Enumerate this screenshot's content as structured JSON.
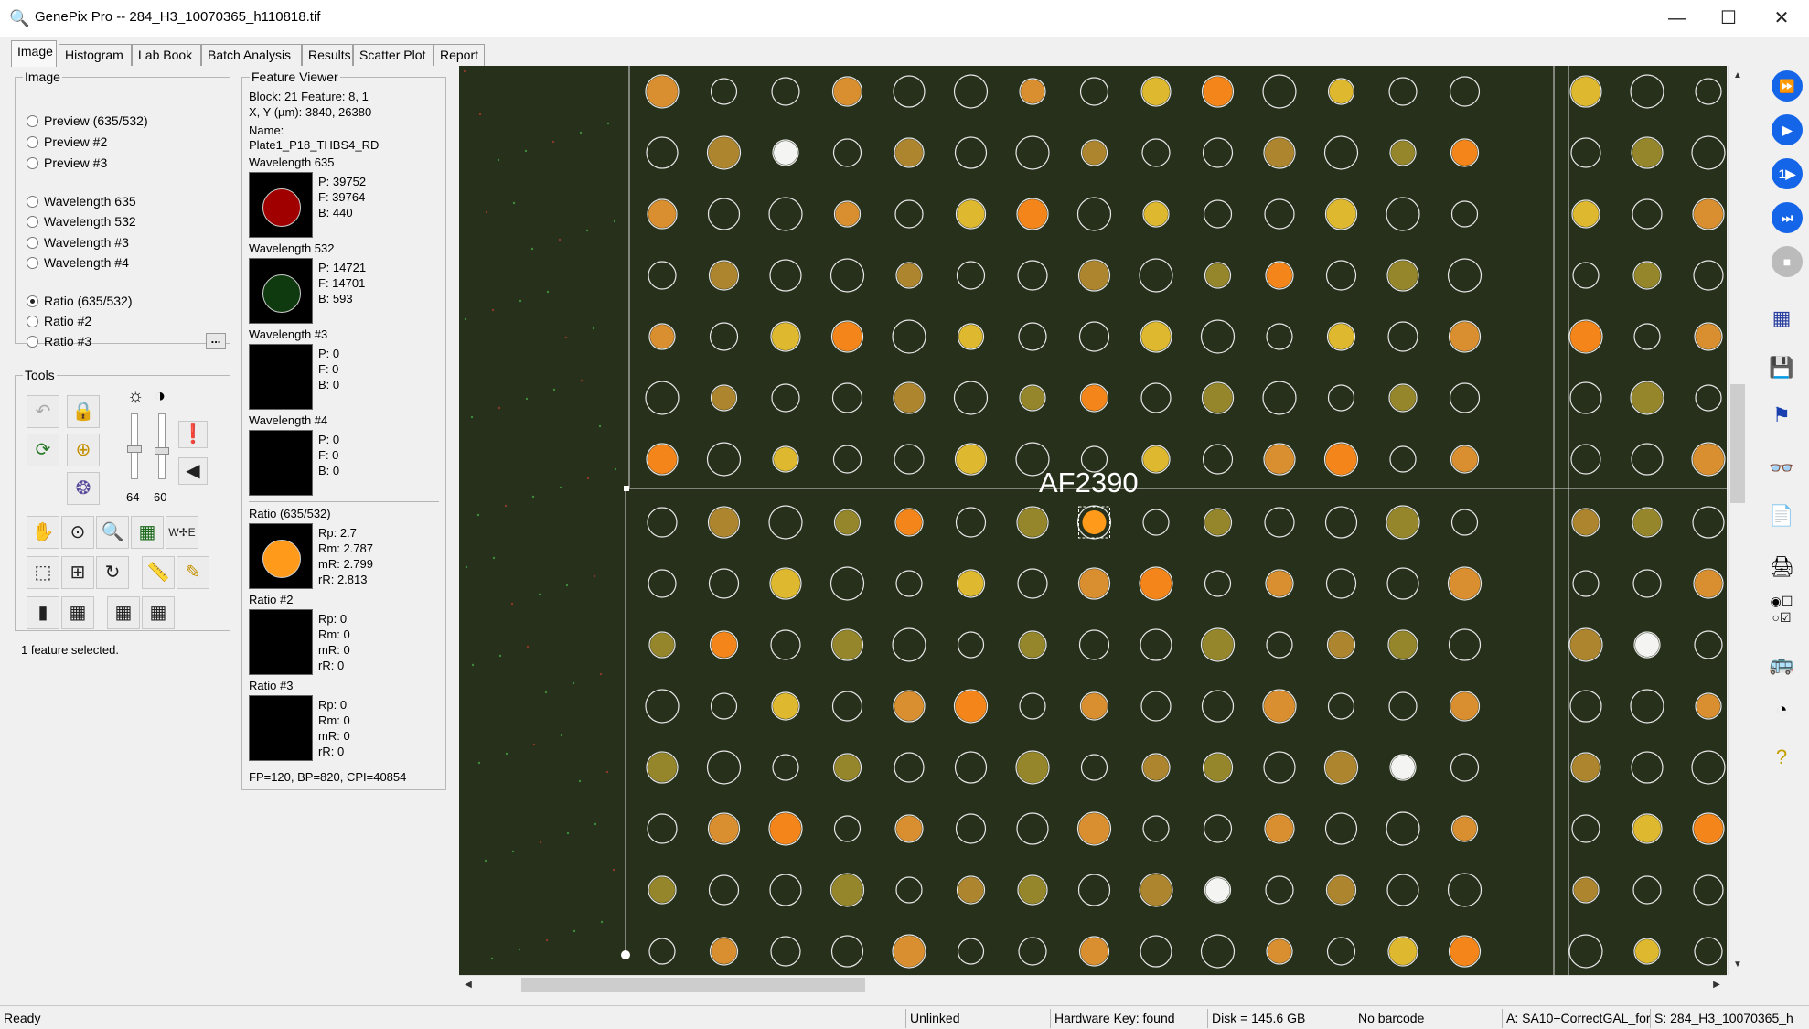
{
  "window": {
    "title": "GenePix Pro -- 284_H3_10070365_h110818.tif",
    "minimize_glyph": "—",
    "maximize_glyph": "☐",
    "close_glyph": "✕"
  },
  "tabs": [
    "Image",
    "Histogram",
    "Lab Book",
    "Batch Analysis",
    "Results",
    "Scatter Plot",
    "Report"
  ],
  "active_tab": "Image",
  "image_group": {
    "legend": "Image",
    "options": [
      "Preview (635/532)",
      "Preview #2",
      "Preview #3",
      "Wavelength 635",
      "Wavelength 532",
      "Wavelength #3",
      "Wavelength #4",
      "Ratio (635/532)",
      "Ratio #2",
      "Ratio #3"
    ],
    "selected": "Ratio (635/532)",
    "more_button": "..."
  },
  "tools_group": {
    "legend": "Tools",
    "brightness_value": "64",
    "contrast_value": "60",
    "brightness_icon": "☼",
    "contrast_icon": "◑",
    "icons": [
      "undo-icon",
      "lock-icon",
      "rotate-icon",
      "target-icon",
      "palette-icon",
      "exclamation-icon",
      "arrow-left-icon",
      "hand-icon",
      "zoom-target-icon",
      "magnifier-icon",
      "grid-calc-icon",
      "compass-icon",
      "select-pointer-icon",
      "add-feature-icon",
      "rotate-select-icon",
      "ruler-icon",
      "pencil-icon",
      "block-single-icon",
      "block-grid-icon",
      "block-grid-add-icon",
      "block-grid-edit-icon"
    ]
  },
  "status_message": "1 feature selected.",
  "feature_viewer": {
    "legend": "Feature Viewer",
    "block_line": "Block: 21      Feature:  8, 1",
    "xy_line": "X, Y (µm): 3840, 26380",
    "name_label": "Name:",
    "name_value": "Plate1_P18_THBS4_RD",
    "sections": [
      {
        "title": "Wavelength 635",
        "lines": [
          "P:   39752",
          "F:   39764",
          "B:   440"
        ],
        "spot_color": "#a00000"
      },
      {
        "title": "Wavelength 532",
        "lines": [
          "P:   14721",
          "F:   14701",
          "B:   593"
        ],
        "spot_color": "#0f3a10"
      },
      {
        "title": "Wavelength #3",
        "lines": [
          "P:   0",
          "F:   0",
          "B:   0"
        ],
        "spot_color": ""
      },
      {
        "title": "Wavelength #4",
        "lines": [
          "P:   0",
          "F:   0",
          "B:   0"
        ],
        "spot_color": ""
      },
      {
        "title": "Ratio (635/532)",
        "lines": [
          "Rp:  2.7",
          "Rm:  2.787",
          "mR:  2.799",
          "rR:  2.813"
        ],
        "spot_color": "#ff9a1a"
      },
      {
        "title": "Ratio #2",
        "lines": [
          "Rp:  0",
          "Rm:  0",
          "mR:  0",
          "rR:  0"
        ],
        "spot_color": ""
      },
      {
        "title": "Ratio #3",
        "lines": [
          "Rp:  0",
          "Rm:  0",
          "mR:  0",
          "rR:  0"
        ],
        "spot_color": ""
      }
    ],
    "footer": "FP=120, BP=820, CPI=40854"
  },
  "image_view": {
    "block_label": "AF2390",
    "background_color": "#27301b",
    "spot_palette": [
      "#c9a13a",
      "#b58a30",
      "#d8b23c",
      "#e39430",
      "#6f7a26",
      "#9b8a2c",
      "#3f6a1e",
      "#e8c030",
      "#ff8a1a",
      "#ffffff"
    ]
  },
  "right_toolbar": {
    "icons": [
      "fast-forward-icon",
      "play-icon",
      "step-icon",
      "batch-play-icon",
      "stop-icon",
      "grid-numbers-icon",
      "save-open-icon",
      "flag-icon",
      "binoculars-icon",
      "report-pages-icon",
      "scanner-icon",
      "radio-check-icon",
      "hardware-icon",
      "gauge-icon",
      "help-icon"
    ]
  },
  "status_bar": {
    "ready": "Ready",
    "link": "Unlinked",
    "hardware": "Hardware Key: found",
    "disk": "Disk = 145.6 GB",
    "barcode": "No barcode",
    "gal": "A: SA10+CorrectGAL_for",
    "settings": "S: 284_H3_10070365_h"
  }
}
